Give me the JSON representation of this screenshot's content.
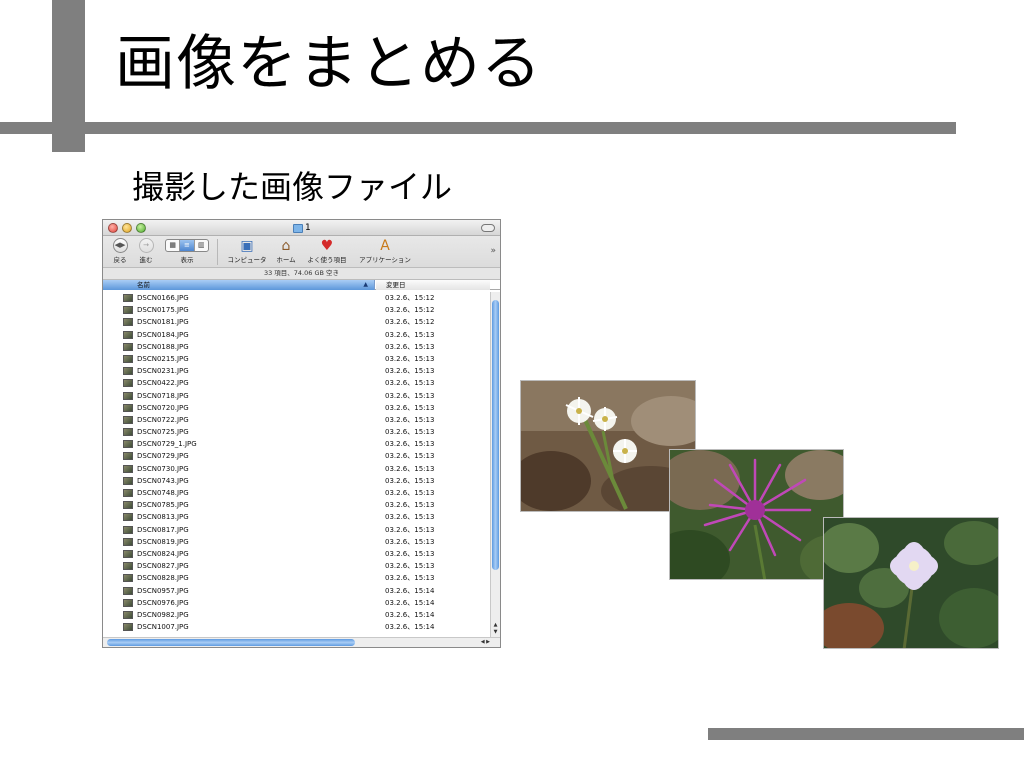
{
  "slide": {
    "title": "画像をまとめる",
    "subtitle": "撮影した画像ファイル"
  },
  "finder": {
    "window_title": "1",
    "toolbar": {
      "back_label": "戻る",
      "forward_label": "進む",
      "view_label": "表示",
      "computer_label": "コンピュータ",
      "home_label": "ホーム",
      "favorites_label": "よく使う項目",
      "applications_label": "アプリケーション"
    },
    "status": "33 項目、74.06 GB 空き",
    "columns": {
      "name": "名前",
      "date": "変更日"
    },
    "files": [
      {
        "name": "DSCN0166.JPG",
        "date": "03.2.6、15:12"
      },
      {
        "name": "DSCN0175.JPG",
        "date": "03.2.6、15:12"
      },
      {
        "name": "DSCN0181.JPG",
        "date": "03.2.6、15:12"
      },
      {
        "name": "DSCN0184.JPG",
        "date": "03.2.6、15:13"
      },
      {
        "name": "DSCN0188.JPG",
        "date": "03.2.6、15:13"
      },
      {
        "name": "DSCN0215.JPG",
        "date": "03.2.6、15:13"
      },
      {
        "name": "DSCN0231.JPG",
        "date": "03.2.6、15:13"
      },
      {
        "name": "DSCN0422.JPG",
        "date": "03.2.6、15:13"
      },
      {
        "name": "DSCN0718.JPG",
        "date": "03.2.6、15:13"
      },
      {
        "name": "DSCN0720.JPG",
        "date": "03.2.6、15:13"
      },
      {
        "name": "DSCN0722.JPG",
        "date": "03.2.6、15:13"
      },
      {
        "name": "DSCN0725.JPG",
        "date": "03.2.6、15:13"
      },
      {
        "name": "DSCN0729_1.JPG",
        "date": "03.2.6、15:13"
      },
      {
        "name": "DSCN0729.JPG",
        "date": "03.2.6、15:13"
      },
      {
        "name": "DSCN0730.JPG",
        "date": "03.2.6、15:13"
      },
      {
        "name": "DSCN0743.JPG",
        "date": "03.2.6、15:13"
      },
      {
        "name": "DSCN0748.JPG",
        "date": "03.2.6、15:13"
      },
      {
        "name": "DSCN0785.JPG",
        "date": "03.2.6、15:13"
      },
      {
        "name": "DSCN0813.JPG",
        "date": "03.2.6、15:13"
      },
      {
        "name": "DSCN0817.JPG",
        "date": "03.2.6、15:13"
      },
      {
        "name": "DSCN0819.JPG",
        "date": "03.2.6、15:13"
      },
      {
        "name": "DSCN0824.JPG",
        "date": "03.2.6、15:13"
      },
      {
        "name": "DSCN0827.JPG",
        "date": "03.2.6、15:13"
      },
      {
        "name": "DSCN0828.JPG",
        "date": "03.2.6、15:13"
      },
      {
        "name": "DSCN0957.JPG",
        "date": "03.2.6、15:14"
      },
      {
        "name": "DSCN0976.JPG",
        "date": "03.2.6、15:14"
      },
      {
        "name": "DSCN0982.JPG",
        "date": "03.2.6、15:14"
      },
      {
        "name": "DSCN1007.JPG",
        "date": "03.2.6、15:14"
      }
    ]
  },
  "colors": {
    "accent_bar": "#7f7f7f",
    "selection_blue": "#5c97da"
  }
}
